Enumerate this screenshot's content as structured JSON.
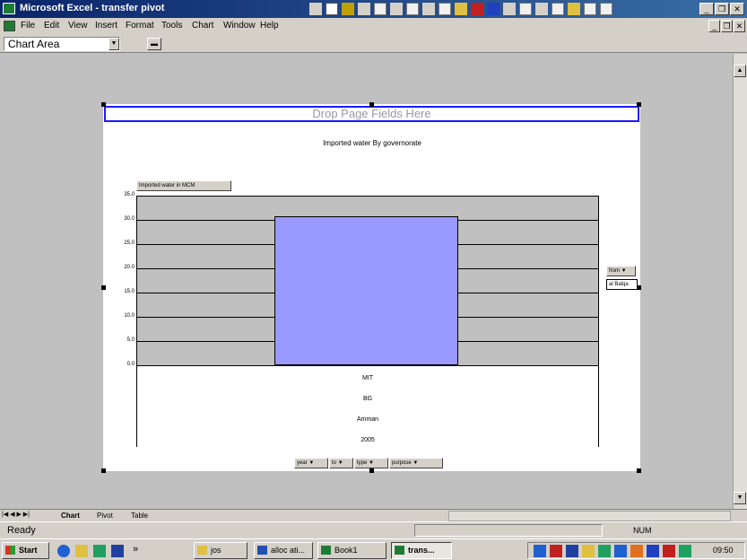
{
  "window": {
    "title": "Microsoft Excel - transfer pivot"
  },
  "menu": {
    "items": [
      "File",
      "Edit",
      "View",
      "Insert",
      "Format",
      "Tools",
      "Chart",
      "Window",
      "Help"
    ]
  },
  "toolbar": {
    "namebox_value": "Chart Area"
  },
  "pivot": {
    "drop_zone": "Drop Page Fields Here",
    "data_field": "Imported water in MCM",
    "series_field": "from",
    "series_item": "al Balqa",
    "category_fields": [
      "year",
      "to",
      "type",
      "purpose"
    ]
  },
  "chart_data": {
    "type": "bar",
    "title": "Imported water By governorate",
    "ylim": [
      0,
      35
    ],
    "yticks": [
      "0.0",
      "5.0",
      "10.0",
      "15.0",
      "20.0",
      "25.0",
      "30.0",
      "35.0"
    ],
    "categories_levels": [
      "MIT",
      "BG",
      "Amman",
      "2005"
    ],
    "series": [
      {
        "name": "al Balqa",
        "values": [
          30.8
        ]
      }
    ]
  },
  "sheets": {
    "tabs": [
      "Chart",
      "Pivot",
      "Table"
    ]
  },
  "status": {
    "text": "Ready",
    "num": "NUM"
  },
  "taskbar": {
    "start": "Start",
    "chevron": "»",
    "items": [
      "jos",
      "alloc ati...",
      "Book1",
      "trans..."
    ],
    "time": "09:50"
  },
  "colors": {
    "bar": "#9999ff",
    "plot_bg": "#c0c0c0",
    "title_bar": "#0a246a",
    "drop_zone_border": "#1a1aff"
  }
}
